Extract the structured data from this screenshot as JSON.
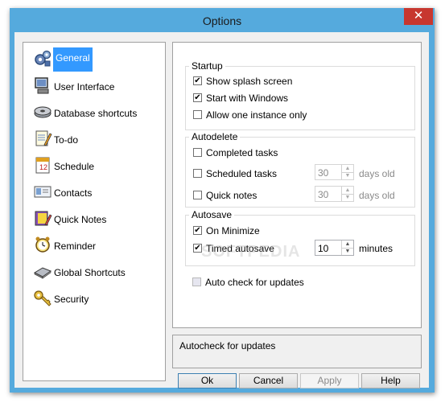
{
  "window": {
    "title": "Options",
    "close_label": "✕"
  },
  "nav": {
    "items": [
      {
        "label": "General",
        "icon": "gears-icon",
        "selected": true
      },
      {
        "label": "User Interface",
        "icon": "monitor-icon"
      },
      {
        "label": "Database shortcuts",
        "icon": "database-disk-icon"
      },
      {
        "label": "To-do",
        "icon": "notepad-pencil-icon"
      },
      {
        "label": "Schedule",
        "icon": "calendar-icon"
      },
      {
        "label": "Contacts",
        "icon": "contact-card-icon"
      },
      {
        "label": "Quick Notes",
        "icon": "notes-book-icon"
      },
      {
        "label": "Reminder",
        "icon": "alarm-clock-icon"
      },
      {
        "label": "Global Shortcuts",
        "icon": "keyboard-icon"
      },
      {
        "label": "Security",
        "icon": "key-icon"
      }
    ]
  },
  "startup": {
    "title": "Startup",
    "show_splash": {
      "label": "Show splash screen",
      "checked": true
    },
    "start_with_windows": {
      "label": "Start with Windows",
      "checked": true
    },
    "one_instance": {
      "label": "Allow one instance only",
      "checked": false
    }
  },
  "autodelete": {
    "title": "Autodelete",
    "completed": {
      "label": "Completed tasks",
      "checked": false
    },
    "scheduled": {
      "label": "Scheduled tasks",
      "checked": false,
      "value": "30",
      "suffix": "days old"
    },
    "quick_notes": {
      "label": "Quick notes",
      "checked": false,
      "value": "30",
      "suffix": "days old"
    }
  },
  "autosave": {
    "title": "Autosave",
    "on_minimize": {
      "label": "On Minimize",
      "checked": true
    },
    "timed": {
      "label": "Timed autosave",
      "checked": true,
      "value": "10",
      "suffix": "minutes"
    }
  },
  "auto_check": {
    "label": "Auto check for updates",
    "checked": false
  },
  "status": {
    "text": "Autocheck for updates"
  },
  "buttons": {
    "ok": "Ok",
    "cancel": "Cancel",
    "apply": "Apply",
    "help": "Help"
  },
  "watermark": "SOFTPEDIA",
  "colors": {
    "titlebar": "#55aadd",
    "close": "#c7372f",
    "selection": "#3399ff"
  }
}
